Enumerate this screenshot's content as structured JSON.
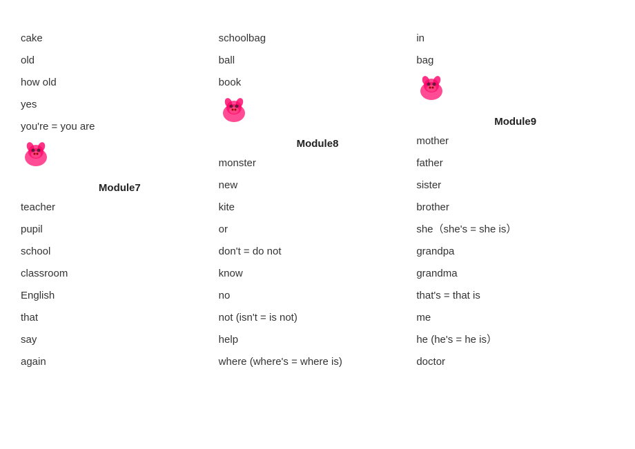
{
  "columns": [
    {
      "id": "col1",
      "items": [
        {
          "type": "text",
          "value": "cake"
        },
        {
          "type": "text",
          "value": "old"
        },
        {
          "type": "text",
          "value": "how old"
        },
        {
          "type": "text",
          "value": "yes"
        },
        {
          "type": "text",
          "value": "you're = you are"
        },
        {
          "type": "icon",
          "value": "pig1"
        },
        {
          "type": "module",
          "value": "Module7"
        },
        {
          "type": "text",
          "value": "teacher"
        },
        {
          "type": "text",
          "value": "pupil"
        },
        {
          "type": "text",
          "value": "school"
        },
        {
          "type": "text",
          "value": "classroom"
        },
        {
          "type": "text",
          "value": "English"
        },
        {
          "type": "text",
          "value": "that"
        },
        {
          "type": "text",
          "value": "say"
        },
        {
          "type": "text",
          "value": "again"
        }
      ]
    },
    {
      "id": "col2",
      "items": [
        {
          "type": "text",
          "value": "schoolbag"
        },
        {
          "type": "text",
          "value": "ball"
        },
        {
          "type": "text",
          "value": "book"
        },
        {
          "type": "icon",
          "value": "pig2"
        },
        {
          "type": "module",
          "value": "Module8"
        },
        {
          "type": "text",
          "value": "monster"
        },
        {
          "type": "text",
          "value": "new"
        },
        {
          "type": "text",
          "value": "kite"
        },
        {
          "type": "text",
          "value": "or"
        },
        {
          "type": "text",
          "value": "don't = do not"
        },
        {
          "type": "text",
          "value": "know"
        },
        {
          "type": "text",
          "value": "no"
        },
        {
          "type": "text",
          "value": "not (isn't = is not)"
        },
        {
          "type": "text",
          "value": "help"
        },
        {
          "type": "text",
          "value": "where (where's = where is)"
        }
      ]
    },
    {
      "id": "col3",
      "items": [
        {
          "type": "text",
          "value": "in"
        },
        {
          "type": "text",
          "value": "bag"
        },
        {
          "type": "icon",
          "value": "pig3"
        },
        {
          "type": "module",
          "value": "Module9"
        },
        {
          "type": "text",
          "value": "mother"
        },
        {
          "type": "text",
          "value": "father"
        },
        {
          "type": "text",
          "value": "sister"
        },
        {
          "type": "text",
          "value": "brother"
        },
        {
          "type": "text",
          "value": "she（she's = she is）"
        },
        {
          "type": "text",
          "value": "grandpa"
        },
        {
          "type": "text",
          "value": "grandma"
        },
        {
          "type": "text",
          "value": "that's = that is"
        },
        {
          "type": "text",
          "value": "me"
        },
        {
          "type": "text",
          "value": "he (he's = he is）"
        },
        {
          "type": "text",
          "value": "doctor"
        }
      ]
    }
  ]
}
